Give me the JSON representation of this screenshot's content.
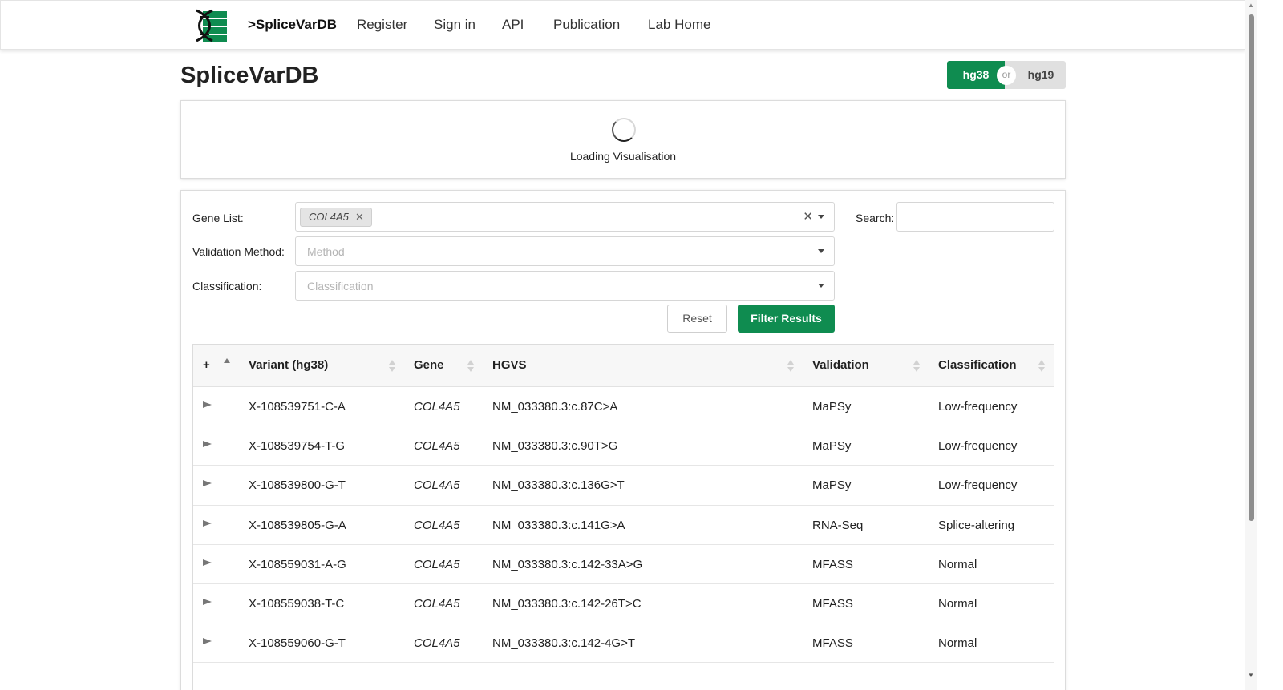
{
  "navbar": {
    "brand": ">SpliceVarDB",
    "links": [
      "Register",
      "Sign in",
      "API",
      "Publication",
      "Lab Home"
    ]
  },
  "page": {
    "title": "SpliceVarDB"
  },
  "genome_toggle": {
    "selected": "hg38",
    "other": "hg19",
    "separator": "or"
  },
  "visualisation": {
    "loading_text": "Loading Visualisation"
  },
  "filters": {
    "gene_list_label": "Gene List:",
    "gene_chips": [
      "COL4A5"
    ],
    "validation_label": "Validation Method:",
    "validation_placeholder": "Method",
    "classification_label": "Classification:",
    "classification_placeholder": "Classification",
    "search_label": "Search:",
    "search_value": "",
    "reset_label": "Reset",
    "filter_label": "Filter Results"
  },
  "table": {
    "expand_all": "+",
    "columns": [
      "Variant (hg38)",
      "Gene",
      "HGVS",
      "Validation",
      "Classification"
    ],
    "rows": [
      {
        "variant": "X-108539751-C-A",
        "gene": "COL4A5",
        "hgvs": "NM_033380.3:c.87C>A",
        "validation": "MaPSy",
        "classification": "Low-frequency"
      },
      {
        "variant": "X-108539754-T-G",
        "gene": "COL4A5",
        "hgvs": "NM_033380.3:c.90T>G",
        "validation": "MaPSy",
        "classification": "Low-frequency"
      },
      {
        "variant": "X-108539800-G-T",
        "gene": "COL4A5",
        "hgvs": "NM_033380.3:c.136G>T",
        "validation": "MaPSy",
        "classification": "Low-frequency"
      },
      {
        "variant": "X-108539805-G-A",
        "gene": "COL4A5",
        "hgvs": "NM_033380.3:c.141G>A",
        "validation": "RNA-Seq",
        "classification": "Splice-altering"
      },
      {
        "variant": "X-108559031-A-G",
        "gene": "COL4A5",
        "hgvs": "NM_033380.3:c.142-33A>G",
        "validation": "MFASS",
        "classification": "Normal"
      },
      {
        "variant": "X-108559038-T-C",
        "gene": "COL4A5",
        "hgvs": "NM_033380.3:c.142-26T>C",
        "validation": "MFASS",
        "classification": "Normal"
      },
      {
        "variant": "X-108559060-G-T",
        "gene": "COL4A5",
        "hgvs": "NM_033380.3:c.142-4G>T",
        "validation": "MFASS",
        "classification": "Normal"
      }
    ]
  },
  "colors": {
    "accent": "#0f8c50"
  }
}
